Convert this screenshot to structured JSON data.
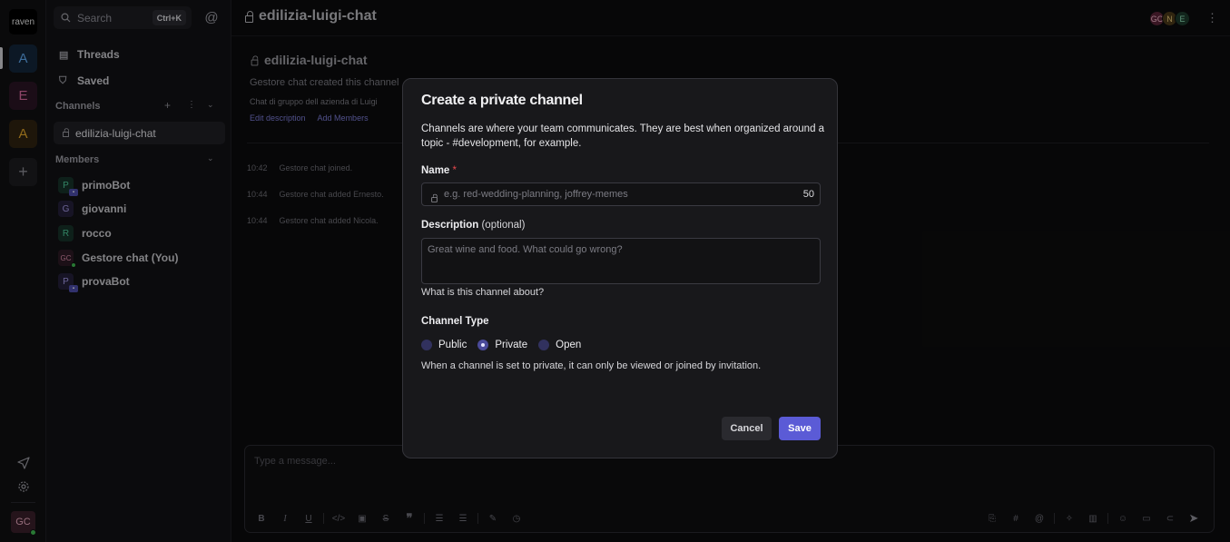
{
  "rail": {
    "logo": "raven",
    "workspaces": [
      {
        "letter": "A",
        "bg": "#13263a",
        "fg": "#5fa8ef"
      },
      {
        "letter": "E",
        "bg": "#2a1424",
        "fg": "#d86a9e"
      },
      {
        "letter": "A",
        "bg": "#2e2210",
        "fg": "#e0a52a"
      }
    ],
    "add_icon": "plus-icon",
    "user_initials": "GC"
  },
  "sidebar": {
    "search_placeholder": "Search",
    "search_shortcut": "Ctrl+K",
    "nav": [
      {
        "label": "Threads",
        "icon": "threads-icon"
      },
      {
        "label": "Saved",
        "icon": "bookmark-icon"
      }
    ],
    "channels_heading": "Channels",
    "channels": [
      {
        "name": "edilizia-luigi-chat"
      }
    ],
    "members_heading": "Members",
    "members": [
      {
        "initial": "P",
        "name": "primoBot",
        "bg": "#163229",
        "fg": "#4ecb9a",
        "bot": true
      },
      {
        "initial": "G",
        "name": "giovanni",
        "bg": "#24203a",
        "fg": "#a69ae8",
        "bot": false
      },
      {
        "initial": "R",
        "name": "rocco",
        "bg": "#163229",
        "fg": "#4ecb9a",
        "bot": false
      },
      {
        "initial": "GC",
        "name": "Gestore chat (You)",
        "bg": "#2c1a24",
        "fg": "#d98aa8",
        "bot": false,
        "online": true
      },
      {
        "initial": "P",
        "name": "provaBot",
        "bg": "#24203a",
        "fg": "#a69ae8",
        "bot": true
      }
    ]
  },
  "header": {
    "channel_title": "edilizia-luigi-chat",
    "avatars": [
      {
        "initials": "GC",
        "bg": "#5a2438",
        "fg": "#f0b6c9"
      },
      {
        "initials": "N",
        "bg": "#4a3a1a",
        "fg": "#e8c87a"
      },
      {
        "initials": "E",
        "bg": "#1c3a2c",
        "fg": "#8fe0b8"
      }
    ]
  },
  "intro": {
    "title": "edilizia-luigi-chat",
    "created_by": "Gestore chat created this channel",
    "description": "Chat di gruppo dell azienda di Luigi",
    "edit_link": "Edit description",
    "add_members_link": "Add Members"
  },
  "messages": [
    {
      "time": "10:42",
      "text": "Gestore chat joined."
    },
    {
      "time": "10:44",
      "text": "Gestore chat added Ernesto."
    },
    {
      "time": "10:44",
      "text": "Gestore chat added Nicola."
    }
  ],
  "composer": {
    "placeholder": "Type a message..."
  },
  "modal": {
    "title": "Create a private channel",
    "description": "Channels are where your team communicates. They are best when organized around a topic - #development, for example.",
    "name_label": "Name",
    "name_required_mark": "*",
    "name_placeholder": "e.g. red-wedding-planning, joffrey-memes",
    "name_char_count": "50",
    "description_label": "Description",
    "description_optional": "(optional)",
    "description_placeholder": "Great wine and food. What could go wrong?",
    "description_hint": "What is this channel about?",
    "channel_type_label": "Channel Type",
    "channel_types": [
      {
        "label": "Public",
        "selected": false
      },
      {
        "label": "Private",
        "selected": true
      },
      {
        "label": "Open",
        "selected": false
      }
    ],
    "channel_type_hint": "When a channel is set to private, it can only be viewed or joined by invitation.",
    "cancel_label": "Cancel",
    "save_label": "Save",
    "accent": "#5b5bd6"
  }
}
